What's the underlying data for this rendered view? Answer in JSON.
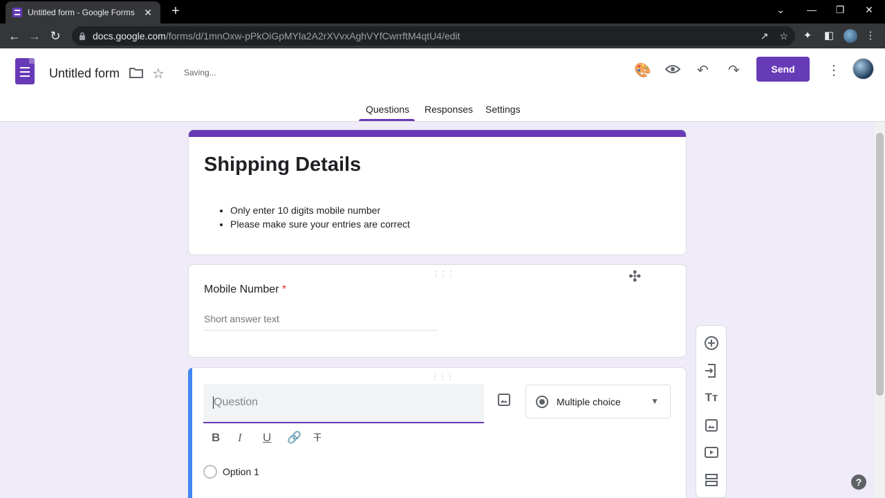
{
  "browser": {
    "tab_title": "Untitled form - Google Forms",
    "tab_close": "✕",
    "new_tab": "+",
    "url_host": "docs.google.com",
    "url_path": "/forms/d/1mnOxw-pPkOiGpMYla2A2rXVvxAghVYfCwrrftM4qtU4/edit"
  },
  "header": {
    "form_title": "Untitled form",
    "status": "Saving...",
    "send_label": "Send",
    "tabs": [
      {
        "label": "Questions",
        "active": true
      },
      {
        "label": "Responses",
        "active": false
      },
      {
        "label": "Settings",
        "active": false
      }
    ],
    "accent_color": "#673ab7"
  },
  "form": {
    "title": "Shipping Details",
    "description_items": [
      "Only enter 10 digits mobile number",
      "Please make sure your entries are correct"
    ],
    "question1": {
      "label": "Mobile Number",
      "required_mark": "*",
      "placeholder": "Short answer text"
    },
    "editing": {
      "question_placeholder": "Question",
      "type": "Multiple choice",
      "option1": "Option 1"
    }
  },
  "help_label": "?"
}
